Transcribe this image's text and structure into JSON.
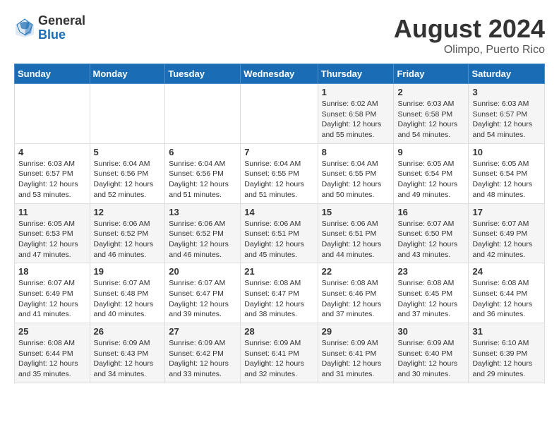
{
  "header": {
    "logo_general": "General",
    "logo_blue": "Blue",
    "month_year": "August 2024",
    "location": "Olimpo, Puerto Rico"
  },
  "weekdays": [
    "Sunday",
    "Monday",
    "Tuesday",
    "Wednesday",
    "Thursday",
    "Friday",
    "Saturday"
  ],
  "weeks": [
    [
      {
        "day": "",
        "info": ""
      },
      {
        "day": "",
        "info": ""
      },
      {
        "day": "",
        "info": ""
      },
      {
        "day": "",
        "info": ""
      },
      {
        "day": "1",
        "info": "Sunrise: 6:02 AM\nSunset: 6:58 PM\nDaylight: 12 hours\nand 55 minutes."
      },
      {
        "day": "2",
        "info": "Sunrise: 6:03 AM\nSunset: 6:58 PM\nDaylight: 12 hours\nand 54 minutes."
      },
      {
        "day": "3",
        "info": "Sunrise: 6:03 AM\nSunset: 6:57 PM\nDaylight: 12 hours\nand 54 minutes."
      }
    ],
    [
      {
        "day": "4",
        "info": "Sunrise: 6:03 AM\nSunset: 6:57 PM\nDaylight: 12 hours\nand 53 minutes."
      },
      {
        "day": "5",
        "info": "Sunrise: 6:04 AM\nSunset: 6:56 PM\nDaylight: 12 hours\nand 52 minutes."
      },
      {
        "day": "6",
        "info": "Sunrise: 6:04 AM\nSunset: 6:56 PM\nDaylight: 12 hours\nand 51 minutes."
      },
      {
        "day": "7",
        "info": "Sunrise: 6:04 AM\nSunset: 6:55 PM\nDaylight: 12 hours\nand 51 minutes."
      },
      {
        "day": "8",
        "info": "Sunrise: 6:04 AM\nSunset: 6:55 PM\nDaylight: 12 hours\nand 50 minutes."
      },
      {
        "day": "9",
        "info": "Sunrise: 6:05 AM\nSunset: 6:54 PM\nDaylight: 12 hours\nand 49 minutes."
      },
      {
        "day": "10",
        "info": "Sunrise: 6:05 AM\nSunset: 6:54 PM\nDaylight: 12 hours\nand 48 minutes."
      }
    ],
    [
      {
        "day": "11",
        "info": "Sunrise: 6:05 AM\nSunset: 6:53 PM\nDaylight: 12 hours\nand 47 minutes."
      },
      {
        "day": "12",
        "info": "Sunrise: 6:06 AM\nSunset: 6:52 PM\nDaylight: 12 hours\nand 46 minutes."
      },
      {
        "day": "13",
        "info": "Sunrise: 6:06 AM\nSunset: 6:52 PM\nDaylight: 12 hours\nand 46 minutes."
      },
      {
        "day": "14",
        "info": "Sunrise: 6:06 AM\nSunset: 6:51 PM\nDaylight: 12 hours\nand 45 minutes."
      },
      {
        "day": "15",
        "info": "Sunrise: 6:06 AM\nSunset: 6:51 PM\nDaylight: 12 hours\nand 44 minutes."
      },
      {
        "day": "16",
        "info": "Sunrise: 6:07 AM\nSunset: 6:50 PM\nDaylight: 12 hours\nand 43 minutes."
      },
      {
        "day": "17",
        "info": "Sunrise: 6:07 AM\nSunset: 6:49 PM\nDaylight: 12 hours\nand 42 minutes."
      }
    ],
    [
      {
        "day": "18",
        "info": "Sunrise: 6:07 AM\nSunset: 6:49 PM\nDaylight: 12 hours\nand 41 minutes."
      },
      {
        "day": "19",
        "info": "Sunrise: 6:07 AM\nSunset: 6:48 PM\nDaylight: 12 hours\nand 40 minutes."
      },
      {
        "day": "20",
        "info": "Sunrise: 6:07 AM\nSunset: 6:47 PM\nDaylight: 12 hours\nand 39 minutes."
      },
      {
        "day": "21",
        "info": "Sunrise: 6:08 AM\nSunset: 6:47 PM\nDaylight: 12 hours\nand 38 minutes."
      },
      {
        "day": "22",
        "info": "Sunrise: 6:08 AM\nSunset: 6:46 PM\nDaylight: 12 hours\nand 37 minutes."
      },
      {
        "day": "23",
        "info": "Sunrise: 6:08 AM\nSunset: 6:45 PM\nDaylight: 12 hours\nand 37 minutes."
      },
      {
        "day": "24",
        "info": "Sunrise: 6:08 AM\nSunset: 6:44 PM\nDaylight: 12 hours\nand 36 minutes."
      }
    ],
    [
      {
        "day": "25",
        "info": "Sunrise: 6:08 AM\nSunset: 6:44 PM\nDaylight: 12 hours\nand 35 minutes."
      },
      {
        "day": "26",
        "info": "Sunrise: 6:09 AM\nSunset: 6:43 PM\nDaylight: 12 hours\nand 34 minutes."
      },
      {
        "day": "27",
        "info": "Sunrise: 6:09 AM\nSunset: 6:42 PM\nDaylight: 12 hours\nand 33 minutes."
      },
      {
        "day": "28",
        "info": "Sunrise: 6:09 AM\nSunset: 6:41 PM\nDaylight: 12 hours\nand 32 minutes."
      },
      {
        "day": "29",
        "info": "Sunrise: 6:09 AM\nSunset: 6:41 PM\nDaylight: 12 hours\nand 31 minutes."
      },
      {
        "day": "30",
        "info": "Sunrise: 6:09 AM\nSunset: 6:40 PM\nDaylight: 12 hours\nand 30 minutes."
      },
      {
        "day": "31",
        "info": "Sunrise: 6:10 AM\nSunset: 6:39 PM\nDaylight: 12 hours\nand 29 minutes."
      }
    ]
  ]
}
